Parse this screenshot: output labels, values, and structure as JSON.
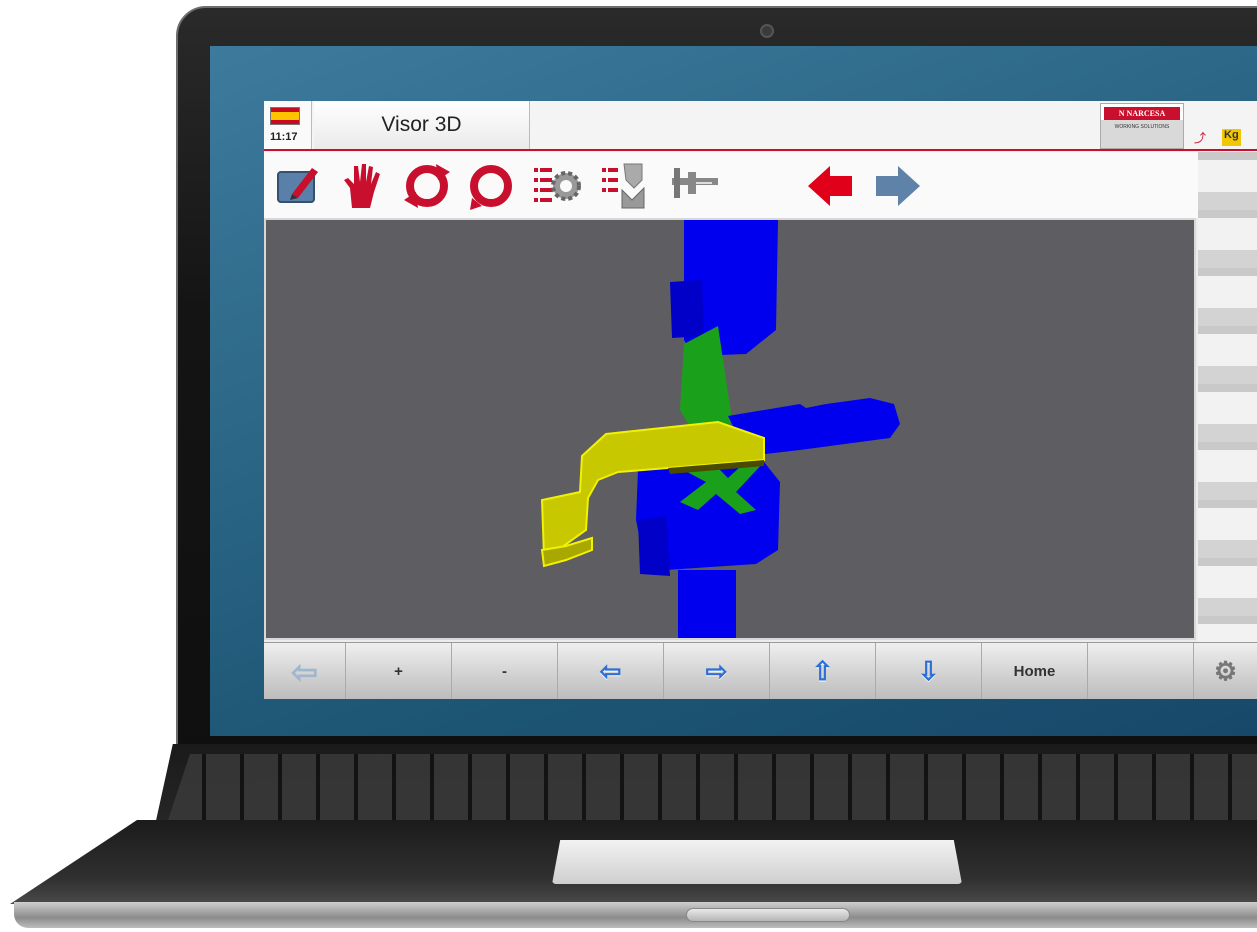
{
  "header": {
    "language_flag": "spain-flag",
    "clock": "11:17",
    "title": "Visor 3D",
    "brand_name": "N NARCESA",
    "brand_tagline": "WORKING SOLUTIONS",
    "mini_icons": [
      "chart-icon",
      "kg-icon"
    ],
    "mini_k": "Kg"
  },
  "toolbar": {
    "tools": [
      "edit-icon",
      "hand-icon",
      "rotate-cw-icon",
      "rotate-ccw-icon",
      "settings-list-icon",
      "bend-check-icon",
      "caliper-icon",
      "prev-arrow-icon",
      "next-arrow-icon"
    ]
  },
  "nav": {
    "back": "⇦",
    "plus": "+",
    "minus": "-",
    "left": "⇦",
    "right": "⇨",
    "up": "⇧",
    "down": "⇩",
    "home": "Home",
    "settings": "⚙"
  },
  "colors": {
    "accent": "#c8102e",
    "tool_blue": "#0000ee",
    "part_yellow": "#c8c800",
    "punch_green": "#1ba01b",
    "viewport_bg": "#5e5e62"
  }
}
